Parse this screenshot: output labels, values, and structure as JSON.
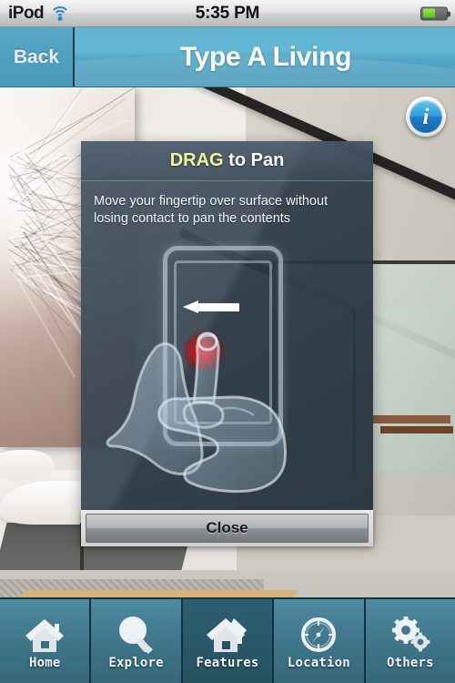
{
  "status_bar": {
    "carrier": "iPod",
    "wifi_icon": "wifi-icon",
    "time": "5:35 PM",
    "battery_icon": "battery-icon",
    "battery_percent": 55
  },
  "nav_bar": {
    "back_label": "Back",
    "title": "Type A Living"
  },
  "content": {
    "info_button_label": "i",
    "info_button_icon": "info-circle-icon"
  },
  "modal": {
    "title_highlight": "DRAG",
    "title_rest": " to Pan",
    "highlight_color": "#f2f39a",
    "body_text": "Move your fingertip over surface without losing contact to pan the contents",
    "illustration": {
      "device_icon": "phone-outline-icon",
      "arrow_icon": "arrow-left-icon",
      "touch_icon": "red-touch-glow-icon",
      "hand_icon": "hand-pointing-icon"
    },
    "close_label": "Close"
  },
  "tab_bar": {
    "active_index": 2,
    "items": [
      {
        "label": "Home",
        "icon": "house-icon"
      },
      {
        "label": "Explore",
        "icon": "magnifier-icon"
      },
      {
        "label": "Features",
        "icon": "house-roof-icon"
      },
      {
        "label": "Location",
        "icon": "compass-icon"
      },
      {
        "label": "Others",
        "icon": "gears-icon"
      }
    ]
  },
  "colors": {
    "nav_blue": "#5aadcc",
    "tab_teal": "#41788d",
    "tab_active_teal": "#29586a",
    "modal_navy": "#2e3d4a",
    "accent_yellow": "#f2f39a",
    "info_blue": "#2f9bdd"
  }
}
